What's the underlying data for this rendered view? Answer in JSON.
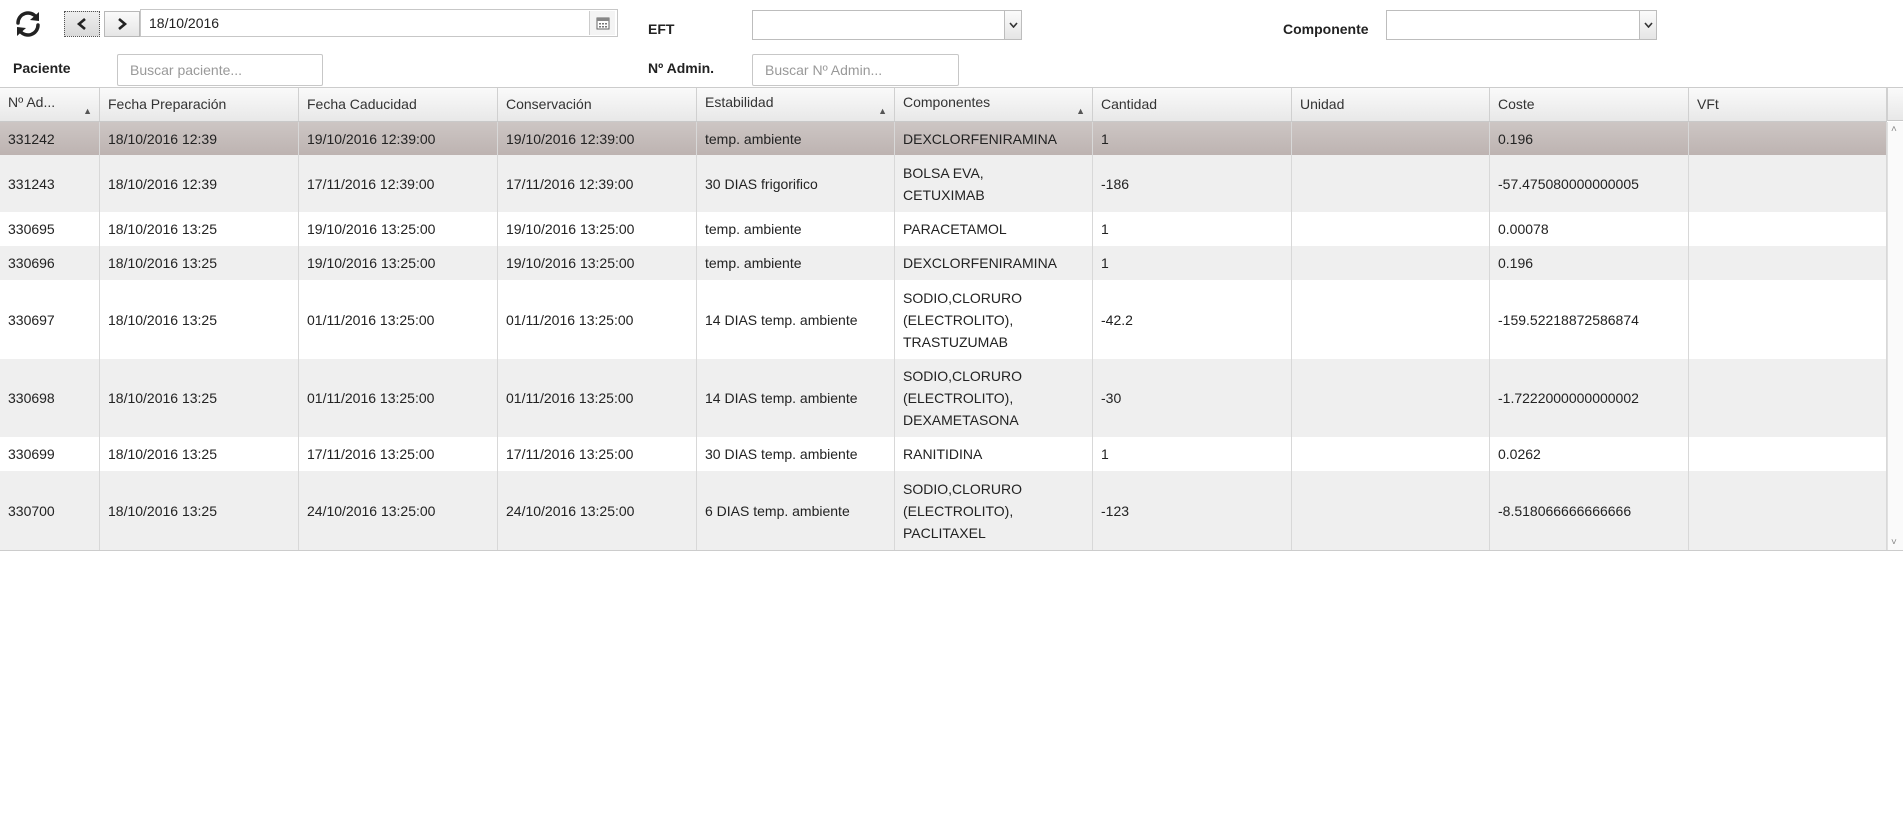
{
  "toolbar": {
    "date_value": "18/10/2016"
  },
  "filters": {
    "paciente_label": "Paciente",
    "paciente_placeholder": "Buscar paciente...",
    "eft_label": "EFT",
    "eft_value": "",
    "admin_label": "Nº Admin.",
    "admin_placeholder": "Buscar Nº Admin...",
    "componente_label": "Componente",
    "componente_value": ""
  },
  "table": {
    "columns": [
      "Nº Ad...",
      "Fecha Preparación",
      "Fecha Caducidad",
      "Conservación",
      "Estabilidad",
      "Componentes",
      "Cantidad",
      "Unidad",
      "Coste",
      "VFt"
    ],
    "rows": [
      {
        "no": "331242",
        "prep": "18/10/2016 12:39",
        "cad": "19/10/2016 12:39:00",
        "cons": "19/10/2016 12:39:00",
        "estab": "temp. ambiente",
        "comp": [
          "DEXCLORFENIRAMINA"
        ],
        "cant": "1",
        "unidad": "",
        "coste": "0.196",
        "vft": ""
      },
      {
        "no": "331243",
        "prep": "18/10/2016 12:39",
        "cad": "17/11/2016 12:39:00",
        "cons": "17/11/2016 12:39:00",
        "estab": "30 DIAS frigorifico",
        "comp": [
          "BOLSA EVA,",
          "CETUXIMAB"
        ],
        "cant": "-186",
        "unidad": "",
        "coste": "-57.475080000000005",
        "vft": ""
      },
      {
        "no": "330695",
        "prep": "18/10/2016 13:25",
        "cad": "19/10/2016 13:25:00",
        "cons": "19/10/2016 13:25:00",
        "estab": "temp. ambiente",
        "comp": [
          "PARACETAMOL"
        ],
        "cant": "1",
        "unidad": "",
        "coste": "0.00078",
        "vft": ""
      },
      {
        "no": "330696",
        "prep": "18/10/2016 13:25",
        "cad": "19/10/2016 13:25:00",
        "cons": "19/10/2016 13:25:00",
        "estab": "temp. ambiente",
        "comp": [
          "DEXCLORFENIRAMINA"
        ],
        "cant": "1",
        "unidad": "",
        "coste": "0.196",
        "vft": ""
      },
      {
        "no": "330697",
        "prep": "18/10/2016 13:25",
        "cad": "01/11/2016 13:25:00",
        "cons": "01/11/2016 13:25:00",
        "estab": "14 DIAS temp. ambiente",
        "comp": [
          "SODIO,CLORURO",
          "(ELECTROLITO),",
          "TRASTUZUMAB"
        ],
        "cant": "-42.2",
        "unidad": "",
        "coste": "-159.52218872586874",
        "vft": ""
      },
      {
        "no": "330698",
        "prep": "18/10/2016 13:25",
        "cad": "01/11/2016 13:25:00",
        "cons": "01/11/2016 13:25:00",
        "estab": "14 DIAS temp. ambiente",
        "comp": [
          "SODIO,CLORURO",
          "(ELECTROLITO),",
          "DEXAMETASONA"
        ],
        "cant": "-30",
        "unidad": "",
        "coste": "-1.7222000000000002",
        "vft": ""
      },
      {
        "no": "330699",
        "prep": "18/10/2016 13:25",
        "cad": "17/11/2016 13:25:00",
        "cons": "17/11/2016 13:25:00",
        "estab": "30 DIAS temp. ambiente",
        "comp": [
          "RANITIDINA"
        ],
        "cant": "1",
        "unidad": "",
        "coste": "0.0262",
        "vft": ""
      },
      {
        "no": "330700",
        "prep": "18/10/2016 13:25",
        "cad": "24/10/2016 13:25:00",
        "cons": "24/10/2016 13:25:00",
        "estab": "6 DIAS temp. ambiente",
        "comp": [
          "SODIO,CLORURO",
          "(ELECTROLITO),",
          "PACLITAXEL"
        ],
        "cant": "-123",
        "unidad": "",
        "coste": "-8.518066666666666",
        "vft": ""
      }
    ]
  },
  "icons": {
    "refresh": "refresh-icon",
    "prev": "chevron-left-icon",
    "next": "chevron-right-icon",
    "calendar": "calendar-icon",
    "dropdown": "chevron-down-icon",
    "sort": "sort-asc-icon"
  },
  "colors": {
    "selected_row": "#c4bbb9",
    "alt_row": "#efefef"
  }
}
